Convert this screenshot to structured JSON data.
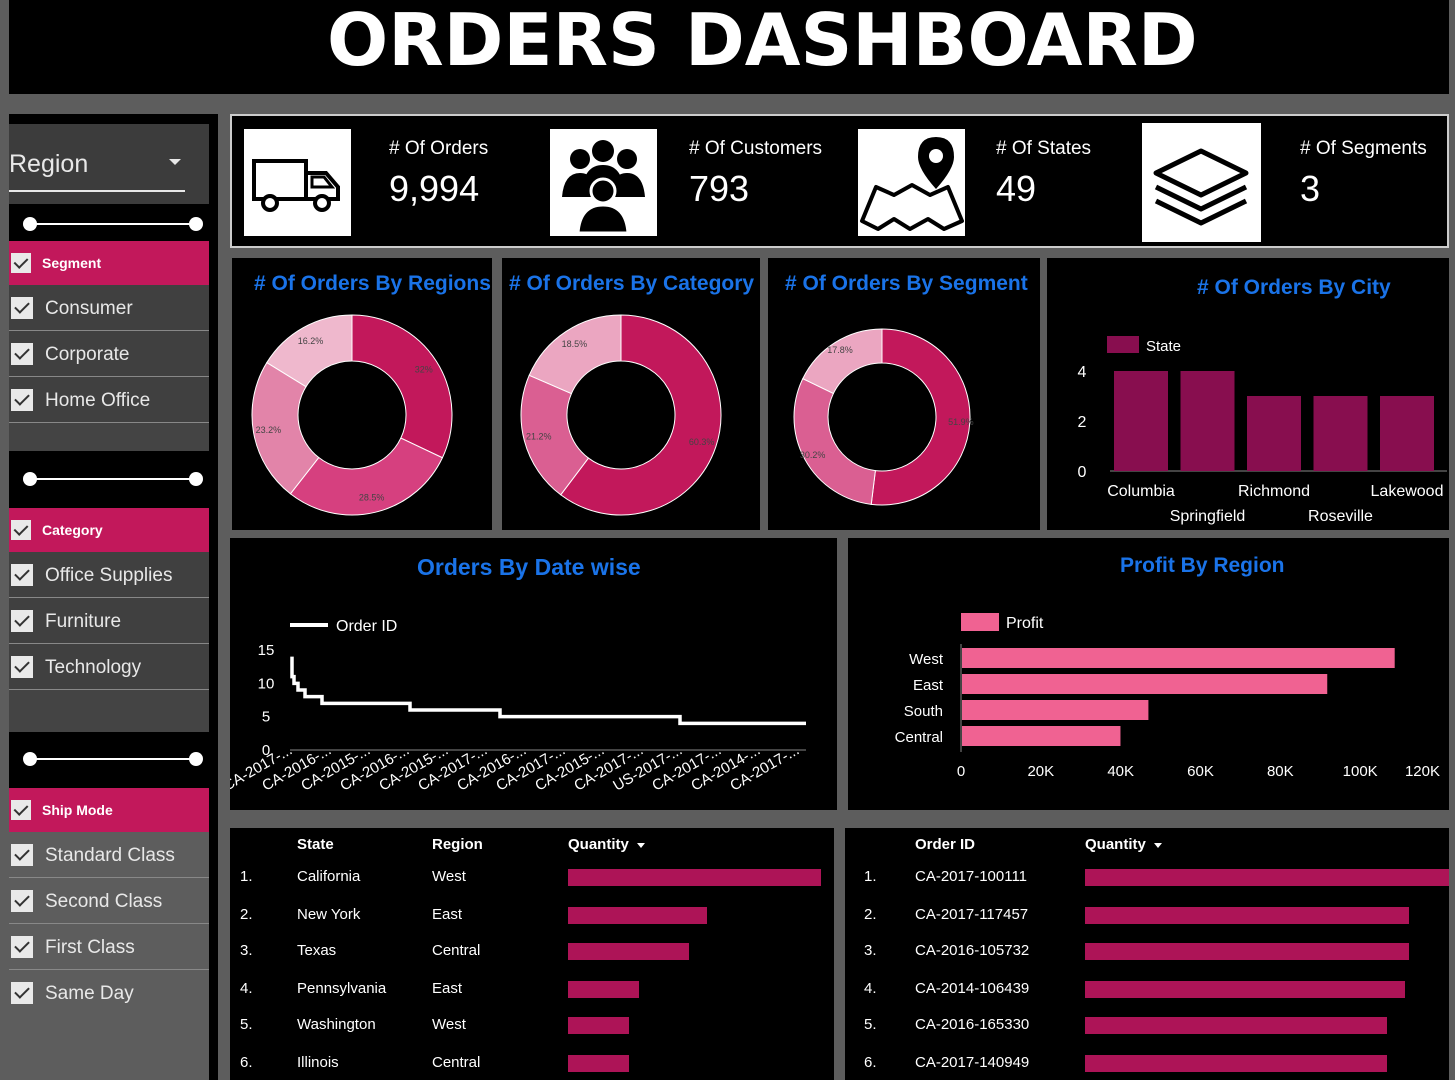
{
  "header": {
    "title": "ORDERS DASHBOARD"
  },
  "sidebar": {
    "region_dropdown": {
      "label": "Region"
    },
    "segment": {
      "title": "Segment",
      "items": [
        "Consumer",
        "Corporate",
        "Home Office"
      ]
    },
    "category": {
      "title": "Category",
      "items": [
        "Office Supplies",
        "Furniture",
        "Technology"
      ]
    },
    "ship_mode": {
      "title": "Ship Mode",
      "items": [
        "Standard Class",
        "Second Class",
        "First Class",
        "Same Day"
      ]
    }
  },
  "kpis": [
    {
      "label": "# Of Orders",
      "value": "9,994",
      "icon": "truck-icon"
    },
    {
      "label": "# Of Customers",
      "value": "793",
      "icon": "people-icon"
    },
    {
      "label": "# Of States",
      "value": "49",
      "icon": "map-pin-icon"
    },
    {
      "label": "# Of Segments",
      "value": "3",
      "icon": "layers-icon"
    }
  ],
  "chart_data": [
    {
      "type": "pie",
      "title": "# Of Orders By Regions",
      "slices": [
        32,
        28.5,
        23.2,
        16.2
      ],
      "labels": [
        "32%",
        "28.5%",
        "23.2%",
        "16.2%"
      ],
      "colors": [
        "#c2185b",
        "#d6407f",
        "#e284a9",
        "#efb8cd"
      ]
    },
    {
      "type": "pie",
      "title": "# Of Orders By Category",
      "slices": [
        60.3,
        21.2,
        18.5
      ],
      "labels": [
        "60.3%",
        "21.2%",
        "18.5%"
      ],
      "colors": [
        "#c2185b",
        "#da5f92",
        "#eba6c1"
      ]
    },
    {
      "type": "pie",
      "title": "# Of Orders By Segment",
      "slices": [
        51.9,
        30.2,
        17.8
      ],
      "labels": [
        "51.9%",
        "30.2%",
        "17.8%"
      ],
      "colors": [
        "#c2185b",
        "#da5f92",
        "#eba6c1"
      ]
    },
    {
      "type": "bar",
      "title": "# Of Orders By City",
      "legend": "State",
      "categories": [
        "Columbia",
        "Springfield",
        "Richmond",
        "Roseville",
        "Lakewood"
      ],
      "values": [
        4,
        4,
        3,
        3,
        3
      ],
      "ylim": [
        0,
        4
      ],
      "yticks": [
        "0",
        "2",
        "4"
      ],
      "color": "#880e4f"
    },
    {
      "type": "line",
      "title": "Orders By Date wise",
      "legend": "Order ID",
      "x": [
        "CA-2017-...",
        "CA-2016-...",
        "CA-2015-...",
        "CA-2016-...",
        "CA-2015-...",
        "CA-2017-...",
        "CA-2016-...",
        "CA-2017-...",
        "CA-2015-...",
        "CA-2017-...",
        "US-2017-...",
        "CA-2017-...",
        "CA-2014-...",
        "CA-2017-..."
      ],
      "values": [
        14,
        11,
        10,
        9,
        8,
        7,
        7,
        7,
        6,
        6,
        5,
        5,
        5,
        4,
        4,
        4,
        4
      ],
      "ylim": [
        0,
        15
      ],
      "yticks": [
        "0",
        "5",
        "10",
        "15"
      ]
    },
    {
      "type": "bar",
      "title": "Profit By Region",
      "legend": "Profit",
      "categories": [
        "West",
        "East",
        "South",
        "Central"
      ],
      "values": [
        108400,
        91500,
        46700,
        39700
      ],
      "xlim": [
        0,
        120000
      ],
      "xticks": [
        "0",
        "20K",
        "40K",
        "60K",
        "80K",
        "100K",
        "120K"
      ],
      "color": "#f06292"
    }
  ],
  "state_table": {
    "headers": [
      "State",
      "Region",
      "Quantity"
    ],
    "rows": [
      {
        "n": "1.",
        "state": "California",
        "region": "West",
        "qty": 1.0
      },
      {
        "n": "2.",
        "state": "New York",
        "region": "East",
        "qty": 0.55
      },
      {
        "n": "3.",
        "state": "Texas",
        "region": "Central",
        "qty": 0.48
      },
      {
        "n": "4.",
        "state": "Pennsylvania",
        "region": "East",
        "qty": 0.28
      },
      {
        "n": "5.",
        "state": "Washington",
        "region": "West",
        "qty": 0.24
      },
      {
        "n": "6.",
        "state": "Illinois",
        "region": "Central",
        "qty": 0.24
      }
    ]
  },
  "order_table": {
    "headers": [
      "Order ID",
      "Quantity"
    ],
    "rows": [
      {
        "n": "1.",
        "id": "CA-2017-100111",
        "qty": 1.0
      },
      {
        "n": "2.",
        "id": "CA-2017-117457",
        "qty": 0.89
      },
      {
        "n": "3.",
        "id": "CA-2016-105732",
        "qty": 0.89
      },
      {
        "n": "4.",
        "id": "CA-2014-106439",
        "qty": 0.88
      },
      {
        "n": "5.",
        "id": "CA-2016-165330",
        "qty": 0.83
      },
      {
        "n": "6.",
        "id": "CA-2017-140949",
        "qty": 0.83
      }
    ]
  }
}
